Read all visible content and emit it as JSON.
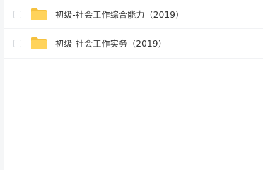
{
  "files": [
    {
      "name": "初级-社会工作综合能力（2019）",
      "icon": "folder-icon",
      "checked": false
    },
    {
      "name": "初级-社会工作实务（2019）",
      "icon": "folder-icon",
      "checked": false
    }
  ],
  "colors": {
    "folder_body": "#ffd35b",
    "folder_tab": "#f5c13f",
    "text": "#333333",
    "divider": "#f1f2f4"
  }
}
